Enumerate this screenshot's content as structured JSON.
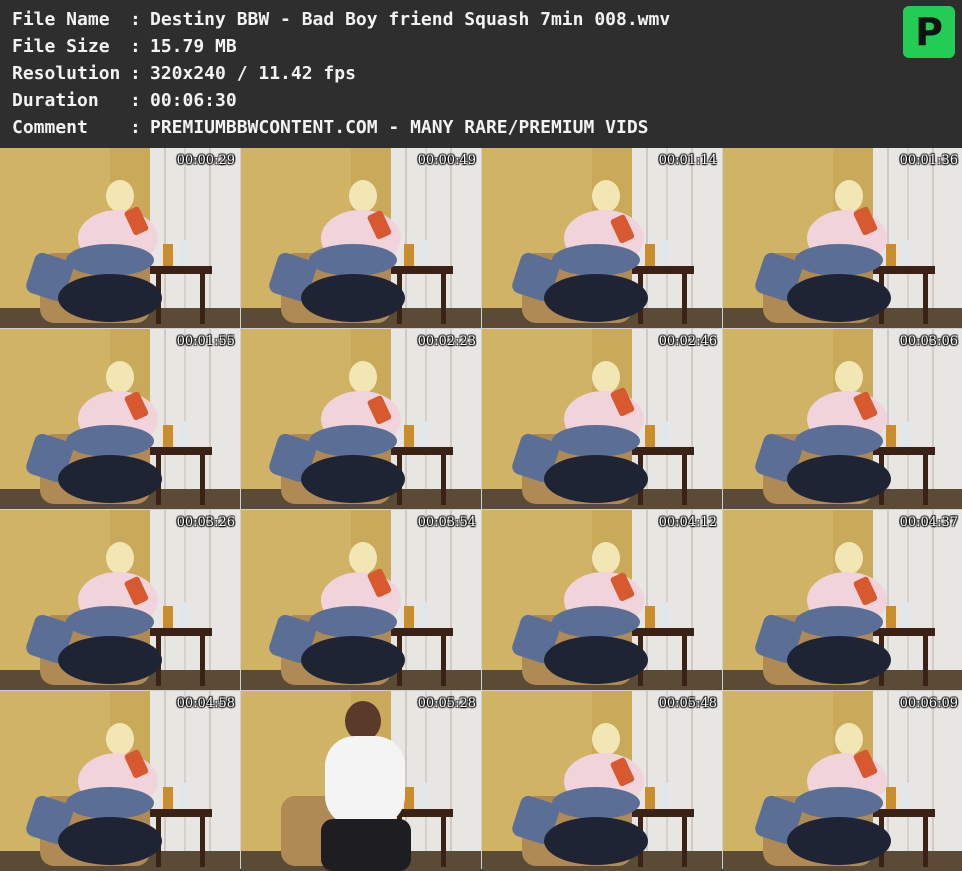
{
  "info": [
    {
      "label": "File Name",
      "sep": ":",
      "value": "Destiny BBW - Bad Boy friend Squash 7min 008.wmv"
    },
    {
      "label": "File Size",
      "sep": ":",
      "value": "15.79 MB"
    },
    {
      "label": "Resolution",
      "sep": ":",
      "value": "320x240 / 11.42 fps"
    },
    {
      "label": "Duration",
      "sep": ":",
      "value": "00:06:30"
    },
    {
      "label": "Comment",
      "sep": ":",
      "value": "PREMIUMBBWCONTENT.COM - MANY RARE/PREMIUM VIDS"
    }
  ],
  "logo": {
    "letter": "P",
    "color": "#22cc55"
  },
  "thumbnails": [
    {
      "time": "00:00:29"
    },
    {
      "time": "00:00:49"
    },
    {
      "time": "00:01:14"
    },
    {
      "time": "00:01:36"
    },
    {
      "time": "00:01:55"
    },
    {
      "time": "00:02:23"
    },
    {
      "time": "00:02:46"
    },
    {
      "time": "00:03:06"
    },
    {
      "time": "00:03:26"
    },
    {
      "time": "00:03:54"
    },
    {
      "time": "00:04:12"
    },
    {
      "time": "00:04:37"
    },
    {
      "time": "00:04:58"
    },
    {
      "time": "00:05:28"
    },
    {
      "time": "00:05:48"
    },
    {
      "time": "00:06:09"
    }
  ],
  "colors": {
    "header_bg": "#2e2e2e",
    "text": "#f2f2f2",
    "wall": "#c9a95a",
    "curtain": "#e8e6e2",
    "jeans": "#5b6f96",
    "shirt": "#f1d3dc",
    "dark_pants": "#1f2435"
  }
}
